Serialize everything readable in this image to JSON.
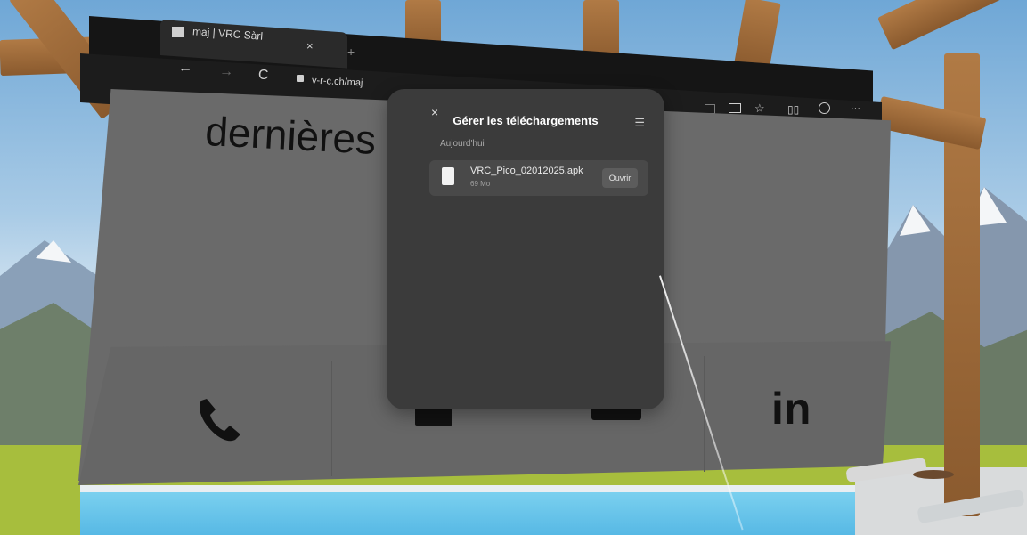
{
  "browser": {
    "tab_title": "maj | VRC Sàrl",
    "url": "v-r-c.ch/maj"
  },
  "page": {
    "headline": "dernières f"
  },
  "download_panel": {
    "title": "Gérer les téléchargements",
    "section": "Aujourd'hui",
    "items": [
      {
        "filename": "VRC_Pico_02012025.apk",
        "size": "69 Mo",
        "action_label": "Ouvrir"
      }
    ]
  },
  "icons": {
    "tab_close": "×",
    "new_tab": "+",
    "back": "←",
    "forward": "→",
    "reload": "C",
    "lock": "🔒",
    "panel_close": "×",
    "panel_list": "☰",
    "phone": "phone-icon",
    "linkedin": "in"
  },
  "colors": {
    "panel_bg": "#3b3b3b",
    "browser_chrome": "#151515",
    "page_bg": "#6a6a6a"
  }
}
